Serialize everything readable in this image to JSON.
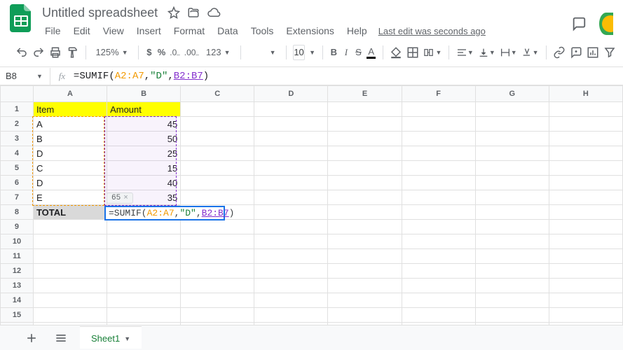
{
  "header": {
    "doc_title": "Untitled spreadsheet",
    "menus": [
      "File",
      "Edit",
      "View",
      "Insert",
      "Format",
      "Data",
      "Tools",
      "Extensions",
      "Help"
    ],
    "last_edit": "Last edit was seconds ago"
  },
  "toolbar": {
    "zoom": "125%",
    "number_format": "123",
    "font_size": "10"
  },
  "formula_bar": {
    "name_box": "B8",
    "prefix": "=SUMIF(",
    "arg1": "A2:A7",
    "sep1": ",",
    "arg2": "\"D\"",
    "sep2": ",",
    "arg3": "B2:B7",
    "suffix": ")"
  },
  "columns": [
    "A",
    "B",
    "C",
    "D",
    "E",
    "F",
    "G",
    "H"
  ],
  "row_count": 16,
  "sheet": {
    "headers": {
      "item": "Item",
      "amount": "Amount"
    },
    "rows": [
      {
        "item": "A",
        "amount": "45"
      },
      {
        "item": "B",
        "amount": "50"
      },
      {
        "item": "D",
        "amount": "25"
      },
      {
        "item": "C",
        "amount": "15"
      },
      {
        "item": "D",
        "amount": "40"
      },
      {
        "item": "E",
        "amount": "35"
      }
    ],
    "total_label": "TOTAL"
  },
  "active_cell": {
    "prefix": "=SUMIF(",
    "arg1": "A2:A7",
    "sep1": ",",
    "arg2": "\"D\"",
    "sep2": ",",
    "arg3": "B2:B7",
    "suffix": ")"
  },
  "preview_tip": "65",
  "footer": {
    "sheet_name": "Sheet1"
  }
}
